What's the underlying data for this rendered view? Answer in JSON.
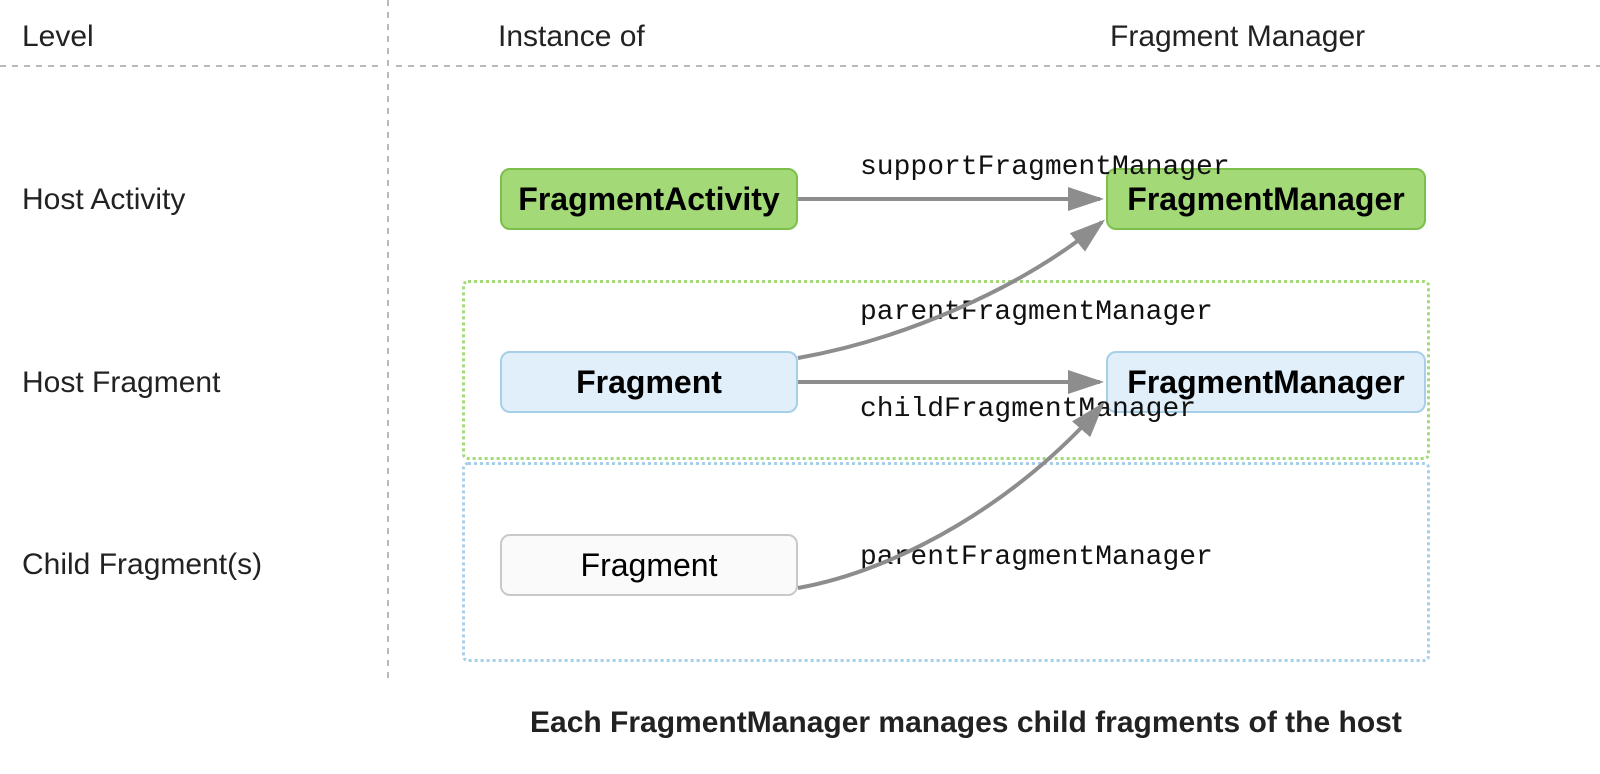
{
  "headers": {
    "level": "Level",
    "instance": "Instance of",
    "manager": "Fragment Manager"
  },
  "rows": {
    "host_activity": "Host Activity",
    "host_fragment": "Host Fragment",
    "child_fragments": "Child Fragment(s)"
  },
  "boxes": {
    "fragment_activity": "FragmentActivity",
    "fragment_manager_green": "FragmentManager",
    "fragment_blue": "Fragment",
    "fragment_manager_blue": "FragmentManager",
    "fragment_gray": "Fragment"
  },
  "edges": {
    "support": "supportFragmentManager",
    "parent1": "parentFragmentManager",
    "child": "childFragmentManager",
    "parent2": "parentFragmentManager"
  },
  "caption": "Each FragmentManager manages child fragments of the host"
}
